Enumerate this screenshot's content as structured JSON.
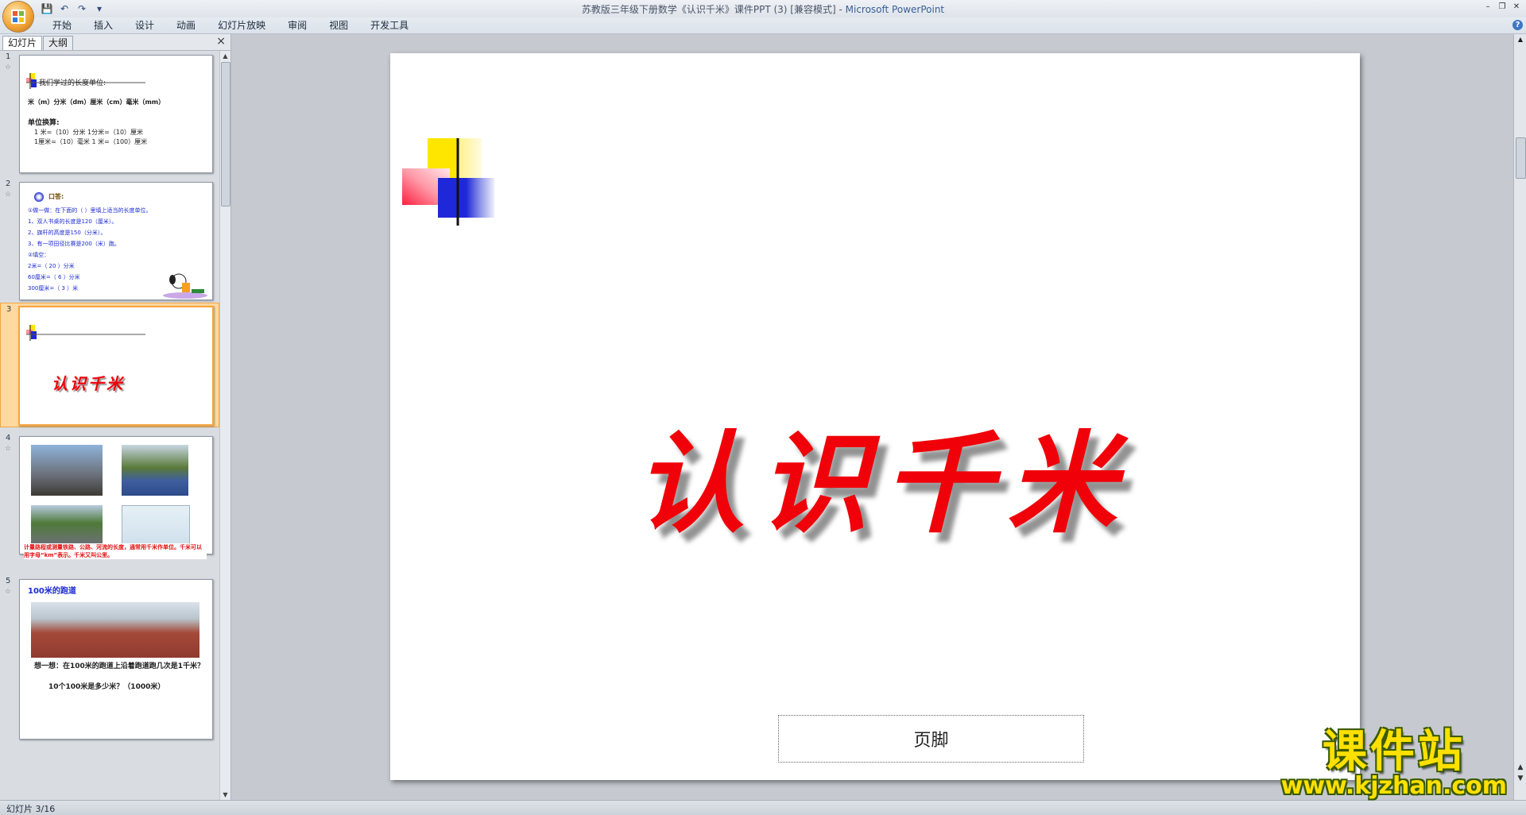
{
  "window": {
    "title": "苏教版三年级下册数学《认识千米》课件PPT (3) [兼容模式] - ",
    "app_name": "Microsoft PowerPoint"
  },
  "quick_access": {
    "icons": [
      "save-icon",
      "undo-icon",
      "redo-icon",
      "customize-icon"
    ]
  },
  "ribbon": {
    "tabs": [
      "开始",
      "插入",
      "设计",
      "动画",
      "幻灯片放映",
      "审阅",
      "视图",
      "开发工具"
    ]
  },
  "panel": {
    "tabs": [
      "幻灯片",
      "大纲"
    ],
    "close_glyph": "×"
  },
  "thumbnails": [
    {
      "number": "1",
      "lines": {
        "heading": "我们学过的长度单位:",
        "units": "米（m）分米（dm）厘米（cm）毫米（mm）",
        "convert_title": "单位换算:",
        "row1": "1 米=（10）分米  1分米=（10）厘米",
        "row2": "1厘米=（10）毫米  1 米=（100）厘米"
      }
    },
    {
      "number": "2",
      "lines": {
        "heading": "口答:",
        "l1": "①做一做：在下面的（ ）里填上适当的长度单位。",
        "l2": "1、双人书桌的长度是120（厘米）。",
        "l3": "2、旗杆的高度是150（分米）。",
        "l4": "3、有一项田径比赛是200（米）跑。",
        "l5": "②填空：",
        "l6": "2米=（ 20 ）分米",
        "l7": "60厘米=（ 6 ）分米",
        "l8": "300厘米=（ 3 ）米"
      }
    },
    {
      "number": "3",
      "title": "认识千米"
    },
    {
      "number": "4",
      "caption": "计量路程或测量铁路、公路、河流的长度，通常用千米作单位。千米可以用字母“km”表示。千米又叫公里。"
    },
    {
      "number": "5",
      "heading": "100米的跑道",
      "question": "想一想：在100米的跑道上沿着跑道跑几次是1千米？",
      "answer_line": "10个100米是多少米？（1000米）"
    }
  ],
  "slide": {
    "title": "认识千米",
    "footer_placeholder": "页脚"
  },
  "status": {
    "text": "幻灯片 3/16"
  },
  "watermark": {
    "cn": "课件站",
    "url": "www.kjzhan.com"
  },
  "colors": {
    "title_red": "#f00008",
    "accent_blue": "#1b2ad0",
    "deco_yellow": "#ffe600"
  }
}
